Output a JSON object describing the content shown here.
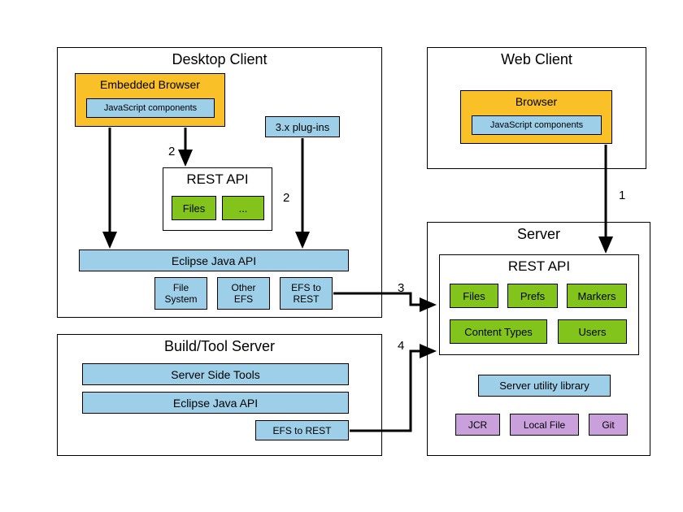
{
  "desktop_client": {
    "title": "Desktop Client",
    "embedded_browser": "Embedded Browser",
    "js_components": "JavaScript components",
    "plugins": "3.x plug-ins",
    "rest_api": {
      "title": "REST API",
      "files": "Files",
      "more": "..."
    },
    "eclipse_api": "Eclipse Java API",
    "fs": "File\nSystem",
    "other_efs": "Other\nEFS",
    "efs_rest": "EFS to\nREST"
  },
  "web_client": {
    "title": "Web Client",
    "browser": "Browser",
    "js_components": "JavaScript components"
  },
  "build_tool": {
    "title": "Build/Tool Server",
    "server_side": "Server Side Tools",
    "eclipse_api": "Eclipse Java API",
    "efs_rest": "EFS to REST"
  },
  "server": {
    "title": "Server",
    "rest_api": {
      "title": "REST API",
      "files": "Files",
      "prefs": "Prefs",
      "markers": "Markers",
      "content_types": "Content Types",
      "users": "Users"
    },
    "utility": "Server utility library",
    "jcr": "JCR",
    "local_file": "Local File",
    "git": "Git"
  },
  "edges": {
    "e1": "1",
    "e2a": "2",
    "e2b": "2",
    "e3": "3",
    "e4": "4"
  }
}
